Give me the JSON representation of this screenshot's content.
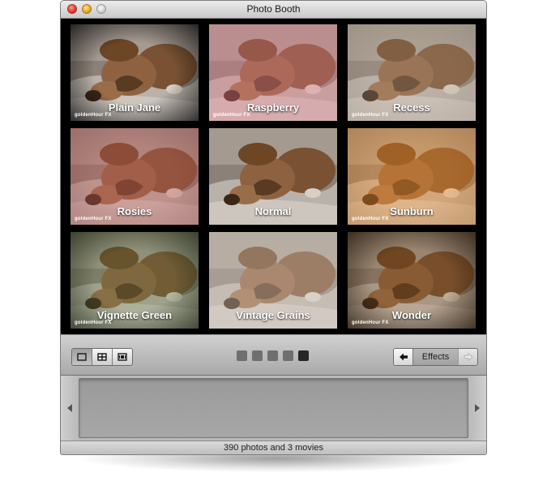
{
  "window": {
    "title": "Photo Booth"
  },
  "effects": [
    {
      "label": "Plain Jane",
      "brand": "goldenHour FX",
      "tint": "rgba(0,0,0,0)",
      "vignette": 0.75
    },
    {
      "label": "Raspberry",
      "brand": "goldenHour FX",
      "tint": "rgba(230,120,140,0.35)",
      "vignette": 0.0
    },
    {
      "label": "Recess",
      "brand": "goldenHour FX",
      "tint": "rgba(190,170,150,0.25)",
      "vignette": 0.1
    },
    {
      "label": "Rosies",
      "brand": "goldenHour FX",
      "tint": "rgba(200,90,90,0.35)",
      "vignette": 0.2
    },
    {
      "label": "Normal",
      "brand": "",
      "tint": "rgba(0,0,0,0)",
      "vignette": 0.0
    },
    {
      "label": "Sunburn",
      "brand": "goldenHour FX",
      "tint": "rgba(255,150,40,0.35)",
      "vignette": 0.2
    },
    {
      "label": "Vignette Green",
      "brand": "goldenHour FX",
      "tint": "rgba(90,120,60,0.28)",
      "vignette": 0.7
    },
    {
      "label": "Vintage Grains",
      "brand": "",
      "tint": "rgba(220,210,200,0.35)",
      "vignette": 0.0
    },
    {
      "label": "Wonder",
      "brand": "goldenHour FX",
      "tint": "rgba(120,70,20,0.25)",
      "vignette": 0.75
    }
  ],
  "toolbar": {
    "view_modes": [
      {
        "name": "single-photo-mode-icon",
        "active": true
      },
      {
        "name": "four-up-mode-icon",
        "active": false
      },
      {
        "name": "movie-mode-icon",
        "active": false
      }
    ],
    "pages": {
      "count": 5,
      "current": 5
    },
    "effects_label": "Effects"
  },
  "status": {
    "text": "390 photos and 3 movies"
  }
}
